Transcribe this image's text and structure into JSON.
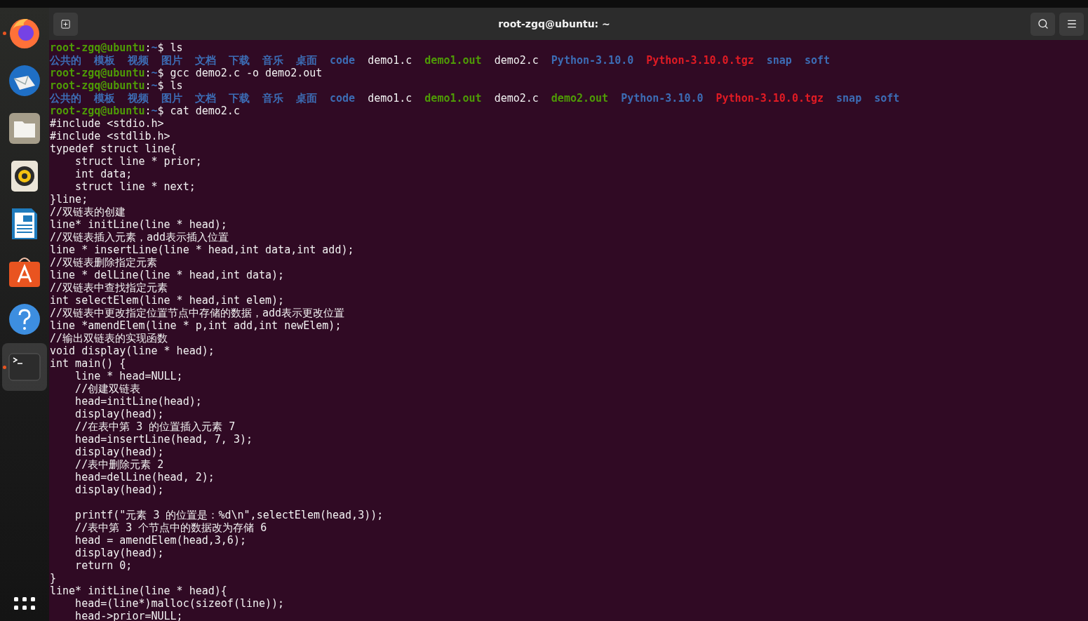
{
  "dock": {
    "items": [
      {
        "kind": "browser",
        "running": true,
        "selected": false
      },
      {
        "kind": "mail",
        "running": false,
        "selected": false
      },
      {
        "kind": "folder",
        "running": false,
        "selected": false
      },
      {
        "kind": "speaker",
        "running": false,
        "selected": false
      },
      {
        "kind": "document",
        "running": false,
        "selected": false
      },
      {
        "kind": "store",
        "running": false,
        "selected": false
      },
      {
        "kind": "help",
        "running": false,
        "selected": false
      },
      {
        "kind": "terminal",
        "running": true,
        "selected": true
      }
    ]
  },
  "window": {
    "title": "root-zgq@ubuntu: ~"
  },
  "terminal": {
    "lines": [
      {
        "kind": "prompt",
        "user": "root-zgq@ubuntu",
        "sep": ":",
        "path": "~",
        "command": "$ ls"
      },
      {
        "kind": "listing",
        "entries": [
          {
            "name": "公共的",
            "kind": "dir"
          },
          {
            "name": "模板",
            "kind": "dir"
          },
          {
            "name": "视频",
            "kind": "dir"
          },
          {
            "name": "图片",
            "kind": "dir"
          },
          {
            "name": "文档",
            "kind": "dir"
          },
          {
            "name": "下载",
            "kind": "dir"
          },
          {
            "name": "音乐",
            "kind": "dir"
          },
          {
            "name": "桌面",
            "kind": "dir"
          },
          {
            "name": "code",
            "kind": "dir"
          },
          {
            "name": "demo1.c",
            "kind": "file"
          },
          {
            "name": "demo1.out",
            "kind": "exec"
          },
          {
            "name": "demo2.c",
            "kind": "file"
          },
          {
            "name": "Python-3.10.0",
            "kind": "dir"
          },
          {
            "name": "Python-3.10.0.tgz",
            "kind": "archive"
          },
          {
            "name": "snap",
            "kind": "dir"
          },
          {
            "name": "soft",
            "kind": "dir"
          }
        ]
      },
      {
        "kind": "prompt",
        "user": "root-zgq@ubuntu",
        "sep": ":",
        "path": "~",
        "command": "$ gcc demo2.c -o demo2.out"
      },
      {
        "kind": "prompt",
        "user": "root-zgq@ubuntu",
        "sep": ":",
        "path": "~",
        "command": "$ ls"
      },
      {
        "kind": "listing",
        "entries": [
          {
            "name": "公共的",
            "kind": "dir"
          },
          {
            "name": "模板",
            "kind": "dir"
          },
          {
            "name": "视频",
            "kind": "dir"
          },
          {
            "name": "图片",
            "kind": "dir"
          },
          {
            "name": "文档",
            "kind": "dir"
          },
          {
            "name": "下载",
            "kind": "dir"
          },
          {
            "name": "音乐",
            "kind": "dir"
          },
          {
            "name": "桌面",
            "kind": "dir"
          },
          {
            "name": "code",
            "kind": "dir"
          },
          {
            "name": "demo1.c",
            "kind": "file"
          },
          {
            "name": "demo1.out",
            "kind": "exec"
          },
          {
            "name": "demo2.c",
            "kind": "file"
          },
          {
            "name": "demo2.out",
            "kind": "exec"
          },
          {
            "name": "Python-3.10.0",
            "kind": "dir"
          },
          {
            "name": "Python-3.10.0.tgz",
            "kind": "archive"
          },
          {
            "name": "snap",
            "kind": "dir"
          },
          {
            "name": "soft",
            "kind": "dir"
          }
        ]
      },
      {
        "kind": "prompt",
        "user": "root-zgq@ubuntu",
        "sep": ":",
        "path": "~",
        "command": "$ cat demo2.c"
      },
      {
        "kind": "code",
        "text": "#include <stdio.h>"
      },
      {
        "kind": "code",
        "text": "#include <stdlib.h>"
      },
      {
        "kind": "code",
        "text": "typedef struct line{"
      },
      {
        "kind": "code",
        "text": "    struct line * prior;"
      },
      {
        "kind": "code",
        "text": "    int data;"
      },
      {
        "kind": "code",
        "text": "    struct line * next;"
      },
      {
        "kind": "code",
        "text": "}line;"
      },
      {
        "kind": "code",
        "text": "//双链表的创建"
      },
      {
        "kind": "code",
        "text": "line* initLine(line * head);"
      },
      {
        "kind": "code",
        "text": "//双链表插入元素，add表示插入位置"
      },
      {
        "kind": "code",
        "text": "line * insertLine(line * head,int data,int add);"
      },
      {
        "kind": "code",
        "text": "//双链表删除指定元素"
      },
      {
        "kind": "code",
        "text": "line * delLine(line * head,int data);"
      },
      {
        "kind": "code",
        "text": "//双链表中查找指定元素"
      },
      {
        "kind": "code",
        "text": "int selectElem(line * head,int elem);"
      },
      {
        "kind": "code",
        "text": "//双链表中更改指定位置节点中存储的数据，add表示更改位置"
      },
      {
        "kind": "code",
        "text": "line *amendElem(line * p,int add,int newElem);"
      },
      {
        "kind": "code",
        "text": "//输出双链表的实现函数"
      },
      {
        "kind": "code",
        "text": "void display(line * head);"
      },
      {
        "kind": "code",
        "text": "int main() {"
      },
      {
        "kind": "code",
        "text": "    line * head=NULL;"
      },
      {
        "kind": "code",
        "text": "    //创建双链表"
      },
      {
        "kind": "code",
        "text": "    head=initLine(head);"
      },
      {
        "kind": "code",
        "text": "    display(head);"
      },
      {
        "kind": "code",
        "text": "    //在表中第 3 的位置插入元素 7"
      },
      {
        "kind": "code",
        "text": "    head=insertLine(head, 7, 3);"
      },
      {
        "kind": "code",
        "text": "    display(head);"
      },
      {
        "kind": "code",
        "text": "    //表中删除元素 2"
      },
      {
        "kind": "code",
        "text": "    head=delLine(head, 2);"
      },
      {
        "kind": "code",
        "text": "    display(head);"
      },
      {
        "kind": "blank"
      },
      {
        "kind": "code",
        "text": "    printf(\"元素 3 的位置是：%d\\n\",selectElem(head,3));"
      },
      {
        "kind": "code",
        "text": "    //表中第 3 个节点中的数据改为存储 6"
      },
      {
        "kind": "code",
        "text": "    head = amendElem(head,3,6);"
      },
      {
        "kind": "code",
        "text": "    display(head);"
      },
      {
        "kind": "code",
        "text": "    return 0;"
      },
      {
        "kind": "code",
        "text": "}"
      },
      {
        "kind": "code",
        "text": "line* initLine(line * head){"
      },
      {
        "kind": "code",
        "text": "    head=(line*)malloc(sizeof(line));"
      },
      {
        "kind": "code",
        "text": "    head->prior=NULL;"
      }
    ]
  }
}
